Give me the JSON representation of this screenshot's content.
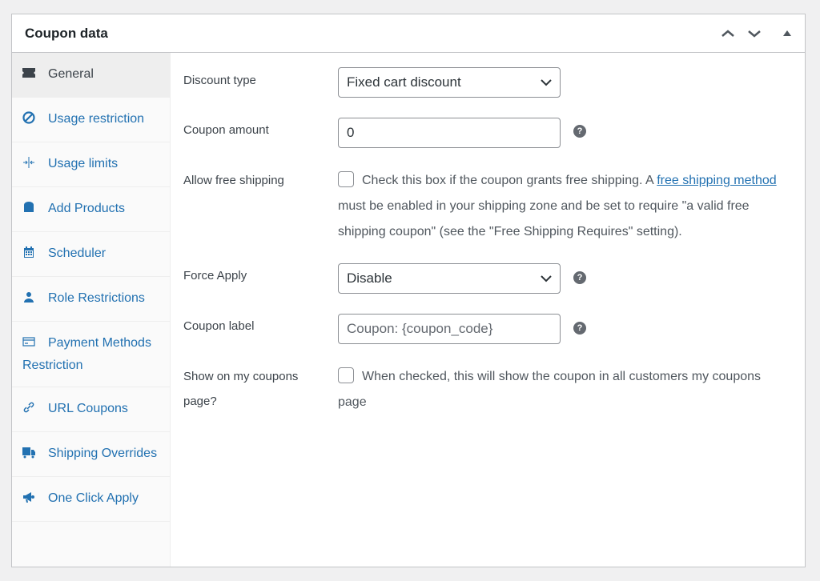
{
  "header": {
    "title": "Coupon data"
  },
  "sidebar": {
    "items": [
      {
        "label": "General",
        "icon": "ticket-icon"
      },
      {
        "label": "Usage restriction",
        "icon": "block-icon"
      },
      {
        "label": "Usage limits",
        "icon": "limits-icon"
      },
      {
        "label": "Add Products",
        "icon": "bag-icon"
      },
      {
        "label": "Scheduler",
        "icon": "calendar-icon"
      },
      {
        "label": "Role Restrictions",
        "icon": "user-icon"
      },
      {
        "label": "Payment Methods Restriction",
        "icon": "card-icon"
      },
      {
        "label": "URL Coupons",
        "icon": "link-icon"
      },
      {
        "label": "Shipping Overrides",
        "icon": "truck-icon"
      },
      {
        "label": "One Click Apply",
        "icon": "megaphone-icon"
      }
    ]
  },
  "fields": {
    "discount_type": {
      "label": "Discount type",
      "value": "Fixed cart discount"
    },
    "coupon_amount": {
      "label": "Coupon amount",
      "value": "0"
    },
    "free_shipping": {
      "label": "Allow free shipping",
      "text1": "Check this box if the coupon grants free shipping. A ",
      "link": "free shipping method",
      "text2": " must be enabled in your shipping zone and be set to require \"a valid free shipping coupon\" (see the \"Free Shipping Requires\" setting)."
    },
    "force_apply": {
      "label": "Force Apply",
      "value": "Disable"
    },
    "coupon_label": {
      "label": "Coupon label",
      "placeholder": "Coupon: {coupon_code}"
    },
    "show_coupons": {
      "label": "Show on my coupons page?",
      "text": "When checked, this will show the coupon in all customers my coupons page"
    }
  },
  "colors": {
    "link": "#2271b1",
    "active_bg": "#eeeeee"
  }
}
